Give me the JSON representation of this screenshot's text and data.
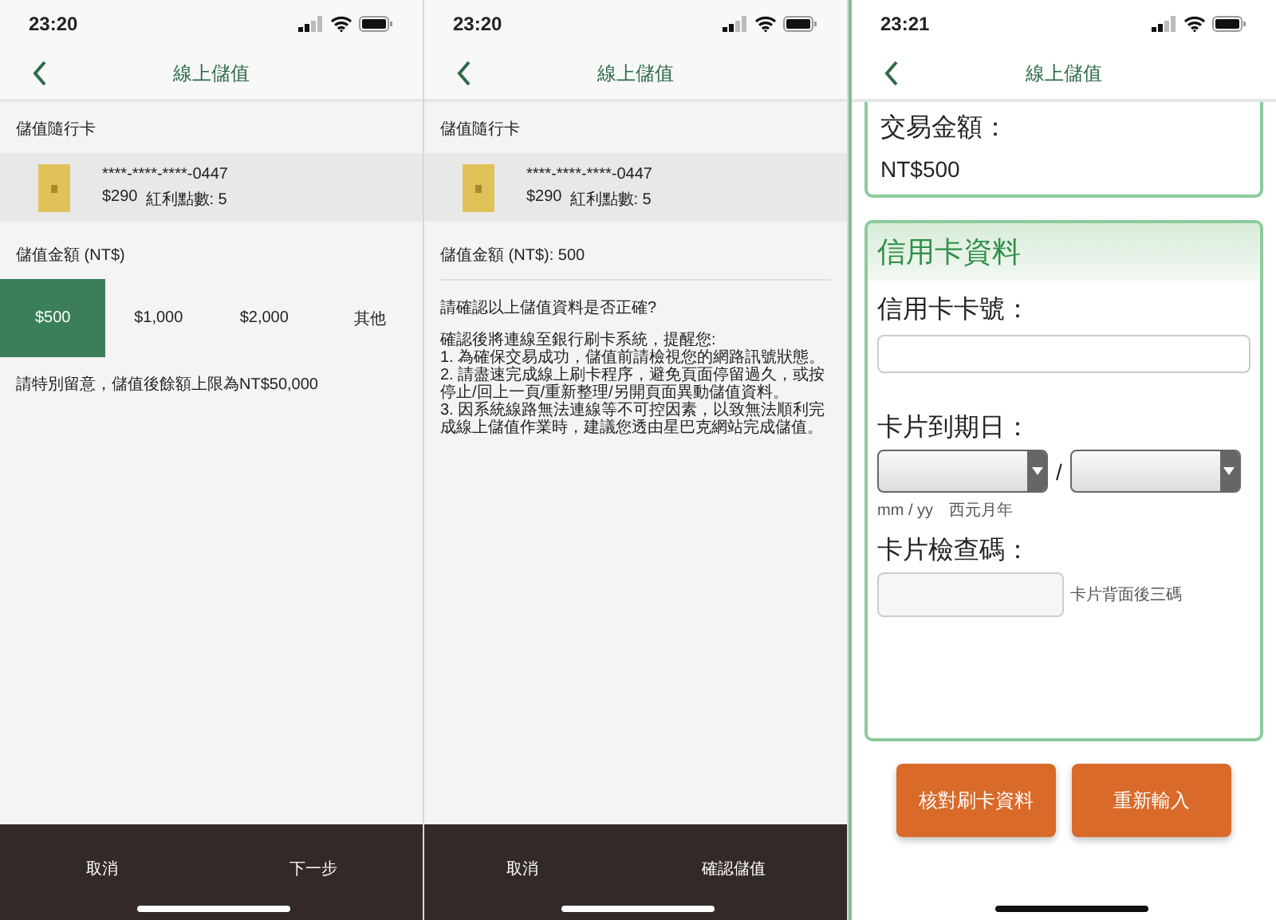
{
  "screens": [
    {
      "kind": "select",
      "status_bar": {
        "time": "23:20"
      },
      "nav": {
        "title": "線上儲值"
      },
      "card_section": {
        "label": "儲值隨行卡",
        "card_number": "****-****-****-0447",
        "balance": "$290",
        "points": "紅利點數: 5"
      },
      "amount_label": "儲值金額 (NT$)",
      "amount_options": [
        {
          "label": "$500",
          "selected": true
        },
        {
          "label": "$1,000",
          "selected": false
        },
        {
          "label": "$2,000",
          "selected": false
        },
        {
          "label": "其他",
          "selected": false
        }
      ],
      "note": "請特別留意，儲值後餘額上限為NT$50,000",
      "bottom_bar": {
        "cancel": "取消",
        "next": "下一步"
      }
    },
    {
      "kind": "confirm",
      "status_bar": {
        "time": "23:20"
      },
      "nav": {
        "title": "線上儲值"
      },
      "card_section": {
        "label": "儲值隨行卡",
        "card_number": "****-****-****-0447",
        "balance": "$290",
        "points": "紅利點數: 5"
      },
      "amount_summary": "儲值金額 (NT$): 500",
      "question": "請確認以上儲值資料是否正確?",
      "notice_lines": [
        "確認後將連線至銀行刷卡系統，提醒您:",
        "1. 為確保交易成功，儲值前請檢視您的網路訊號狀態。",
        "2. 請盡速完成線上刷卡程序，避免頁面停留過久，或按停止/回上一頁/重新整理/另開頁面異動儲值資料。",
        "3. 因系統線路無法連線等不可控因素，以致無法順利完成線上儲值作業時，建議您透由星巴克網站完成儲值。"
      ],
      "bottom_bar": {
        "cancel": "取消",
        "next": "確認儲值"
      }
    },
    {
      "kind": "payment",
      "status_bar": {
        "time": "23:21"
      },
      "nav": {
        "title": "線上儲值"
      },
      "transaction": {
        "label": "交易金額：",
        "amount": "NT$500"
      },
      "credit_card": {
        "title": "信用卡資料",
        "number_label": "信用卡卡號：",
        "expiry_label": "卡片到期日：",
        "expiry_separator": "/",
        "expiry_hint": "mm / yy　西元月年",
        "cvv_label": "卡片檢查碼：",
        "cvv_hint": "卡片背面後三碼"
      },
      "buttons": [
        "核對刷卡資料",
        "重新輸入"
      ]
    }
  ]
}
